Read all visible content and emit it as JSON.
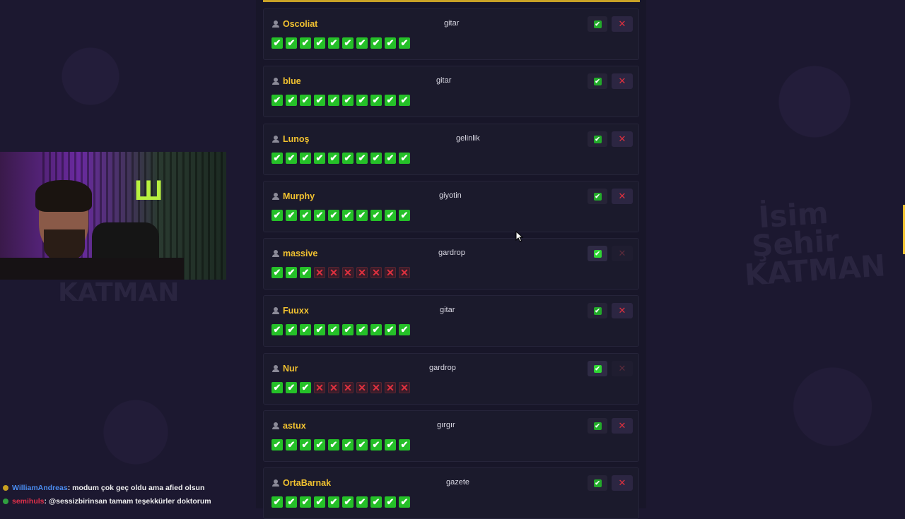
{
  "players": [
    {
      "name": "Oscoliat",
      "word": "gitar",
      "marks": [
        "ok",
        "ok",
        "ok",
        "ok",
        "ok",
        "ok",
        "ok",
        "ok",
        "ok",
        "ok"
      ],
      "accept_active": false,
      "reject_muted": false
    },
    {
      "name": "blue",
      "word": "gitar",
      "marks": [
        "ok",
        "ok",
        "ok",
        "ok",
        "ok",
        "ok",
        "ok",
        "ok",
        "ok",
        "ok"
      ],
      "accept_active": false,
      "reject_muted": false
    },
    {
      "name": "Lunoş",
      "word": "gelinlik",
      "marks": [
        "ok",
        "ok",
        "ok",
        "ok",
        "ok",
        "ok",
        "ok",
        "ok",
        "ok",
        "ok"
      ],
      "accept_active": false,
      "reject_muted": false
    },
    {
      "name": "Murphy",
      "word": "giyotin",
      "marks": [
        "ok",
        "ok",
        "ok",
        "ok",
        "ok",
        "ok",
        "ok",
        "ok",
        "ok",
        "ok"
      ],
      "accept_active": false,
      "reject_muted": false
    },
    {
      "name": "massive",
      "word": "gardrop",
      "marks": [
        "ok",
        "ok",
        "ok",
        "no",
        "no",
        "no",
        "no",
        "no",
        "no",
        "no"
      ],
      "accept_active": true,
      "reject_muted": true
    },
    {
      "name": "Fuuxx",
      "word": "gitar",
      "marks": [
        "ok",
        "ok",
        "ok",
        "ok",
        "ok",
        "ok",
        "ok",
        "ok",
        "ok",
        "ok"
      ],
      "accept_active": false,
      "reject_muted": false
    },
    {
      "name": "Nur",
      "word": "gardrop",
      "marks": [
        "ok",
        "ok",
        "ok",
        "no",
        "no",
        "no",
        "no",
        "no",
        "no",
        "no"
      ],
      "accept_active": true,
      "reject_muted": true
    },
    {
      "name": "astux",
      "word": "gırgır",
      "marks": [
        "ok",
        "ok",
        "ok",
        "ok",
        "ok",
        "ok",
        "ok",
        "ok",
        "ok",
        "ok"
      ],
      "accept_active": false,
      "reject_muted": false
    },
    {
      "name": "OrtaBarnak",
      "word": "gazete",
      "marks": [
        "ok",
        "ok",
        "ok",
        "ok",
        "ok",
        "ok",
        "ok",
        "ok",
        "ok",
        "ok"
      ],
      "accept_active": false,
      "reject_muted": false
    }
  ],
  "chat": [
    {
      "user": "WilliamAndreas",
      "message": ": modum çok geç oldu ama afied olsun",
      "dot_color": "#c8a020"
    },
    {
      "user": "semihuls",
      "message": ": @sessizbirinsan tamam teşekkürler doktorum",
      "dot_color": "#30a040"
    }
  ],
  "watermark": {
    "line1": "İsim",
    "line2": "Şehir",
    "line3": "KATMAN",
    "left": "KATMAN"
  },
  "marks_symbols": {
    "ok": "✔",
    "no": "✕"
  },
  "accept_symbol": "✔",
  "reject_symbol": "✕",
  "colors": {
    "accent": "#f2c230",
    "ok": "#25c028",
    "no": "#e0313f"
  }
}
